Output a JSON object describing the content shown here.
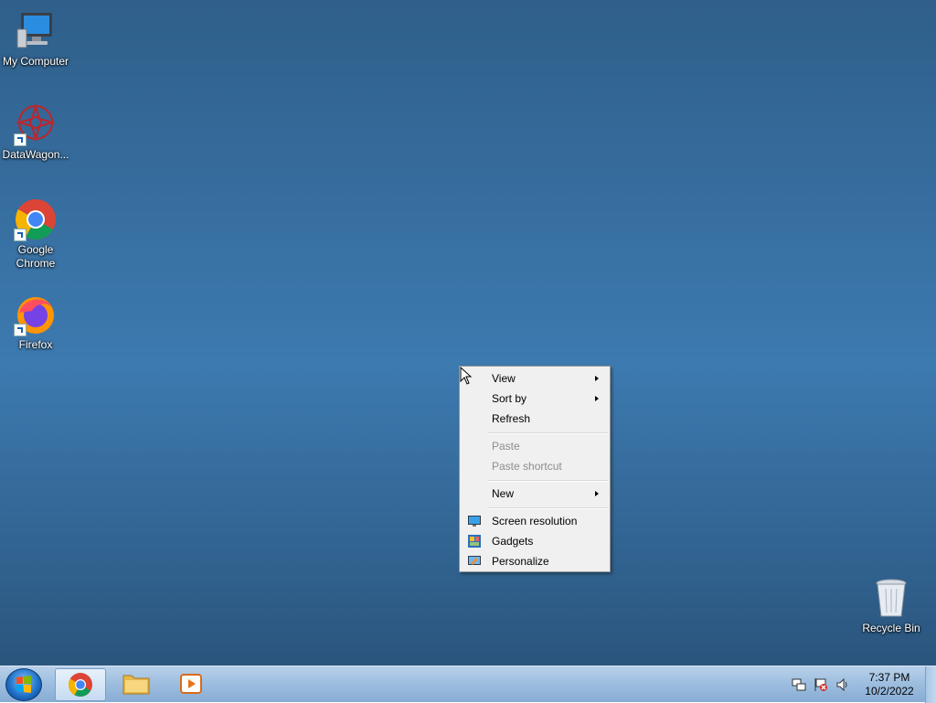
{
  "desktop": {
    "icons": [
      {
        "label": "My Computer"
      },
      {
        "label": "DataWagon..."
      },
      {
        "label": "Google Chrome"
      },
      {
        "label": "Firefox"
      },
      {
        "label": "Recycle Bin"
      }
    ]
  },
  "context_menu": {
    "items": [
      {
        "label": "View"
      },
      {
        "label": "Sort by"
      },
      {
        "label": "Refresh"
      },
      {
        "label": "Paste"
      },
      {
        "label": "Paste shortcut"
      },
      {
        "label": "New"
      },
      {
        "label": "Screen resolution"
      },
      {
        "label": "Gadgets"
      },
      {
        "label": "Personalize"
      }
    ]
  },
  "taskbar": {
    "clock_time": "7:37 PM",
    "clock_date": "10/2/2022"
  },
  "colors": {
    "menu_bg": "#f0f0f0",
    "disabled_text": "#8d8d8d",
    "taskbar": "#9fbfe0"
  }
}
